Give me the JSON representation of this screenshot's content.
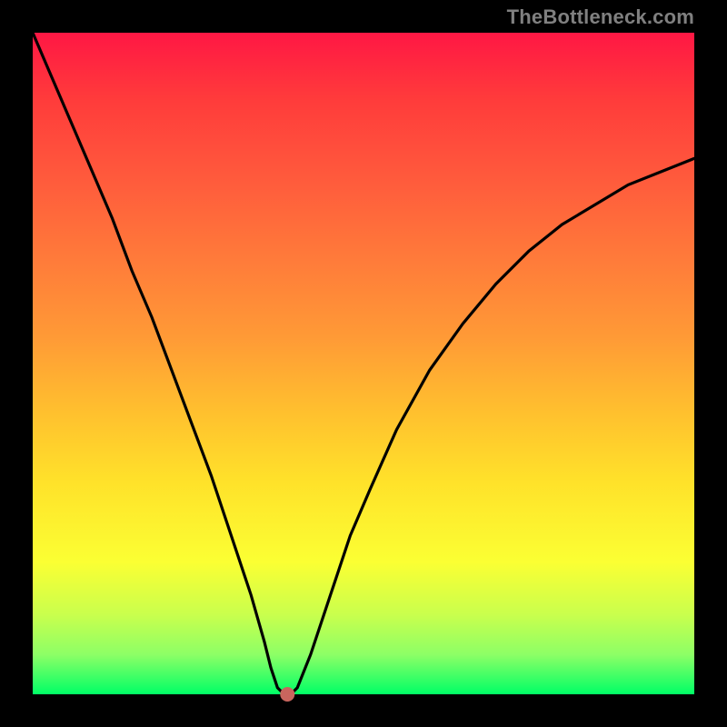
{
  "watermark": "TheBottleneck.com",
  "chart_data": {
    "type": "line",
    "title": "",
    "xlabel": "",
    "ylabel": "",
    "xlim": [
      0,
      100
    ],
    "ylim": [
      0,
      100
    ],
    "series": [
      {
        "name": "curve",
        "x": [
          0,
          3,
          6,
          9,
          12,
          15,
          18,
          21,
          24,
          27,
          30,
          33,
          35,
          36,
          37,
          38,
          39,
          40,
          42,
          45,
          48,
          51,
          55,
          60,
          65,
          70,
          75,
          80,
          85,
          90,
          95,
          100
        ],
        "values": [
          100,
          93,
          86,
          79,
          72,
          64,
          57,
          49,
          41,
          33,
          24,
          15,
          8,
          4,
          1,
          0,
          0,
          1,
          6,
          15,
          24,
          31,
          40,
          49,
          56,
          62,
          67,
          71,
          74,
          77,
          79,
          81
        ]
      }
    ],
    "marker": {
      "x": 38.5,
      "y": 0
    },
    "colors": {
      "curve": "#000000",
      "marker": "#c9655e",
      "gradient_top": "#ff1744",
      "gradient_bottom": "#00ff66",
      "frame": "#000000"
    }
  }
}
